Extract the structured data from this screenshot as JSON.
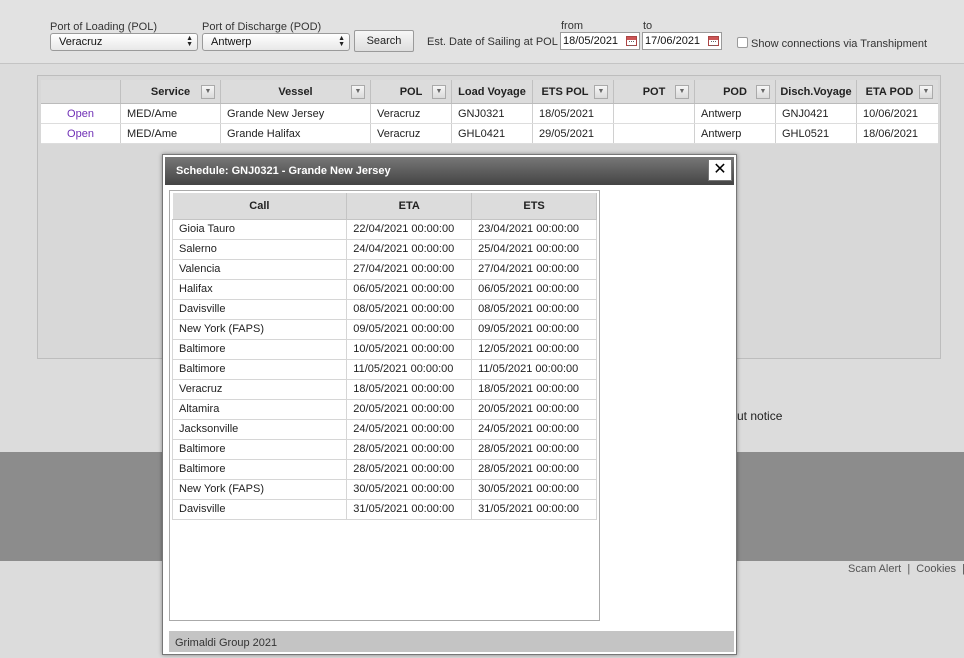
{
  "search": {
    "pol_label": "Port of Loading (POL)",
    "pol_value": "Veracruz",
    "pod_label": "Port of Discharge (POD)",
    "pod_value": "Antwerp",
    "search_button": "Search",
    "sailing_label": "Est. Date of Sailing at POL",
    "from_label": "from",
    "from_value": "18/05/2021",
    "to_label": "to",
    "to_value": "17/06/2021",
    "transhipment_label": "Show connections via Transhipment"
  },
  "results": {
    "columns": [
      "",
      "Service",
      "Vessel",
      "POL",
      "Load Voyage",
      "ETS POL",
      "POT",
      "POD",
      "Disch.Voyage",
      "ETA POD"
    ],
    "rows": [
      [
        "Open",
        "MED/Ame",
        "Grande New Jersey",
        "Veracruz",
        "GNJ0321",
        "18/05/2021",
        "",
        "Antwerp",
        "GNJ0421",
        "10/06/2021"
      ],
      [
        "Open",
        "MED/Ame",
        "Grande Halifax",
        "Veracruz",
        "GHL0421",
        "29/05/2021",
        "",
        "Antwerp",
        "GHL0521",
        "18/06/2021"
      ]
    ]
  },
  "notice_text": "ut notice",
  "footer_links": {
    "scam": "Scam Alert",
    "sep": "|",
    "cookies": "Cookies",
    "sep2": "|"
  },
  "modal": {
    "title": "Schedule: GNJ0321 - Grande New Jersey",
    "close": "✕",
    "columns": [
      "Call",
      "ETA",
      "ETS"
    ],
    "rows": [
      [
        "Gioia Tauro",
        "22/04/2021 00:00:00",
        "23/04/2021 00:00:00"
      ],
      [
        "Salerno",
        "24/04/2021 00:00:00",
        "25/04/2021 00:00:00"
      ],
      [
        "Valencia",
        "27/04/2021 00:00:00",
        "27/04/2021 00:00:00"
      ],
      [
        "Halifax",
        "06/05/2021 00:00:00",
        "06/05/2021 00:00:00"
      ],
      [
        "Davisville",
        "08/05/2021 00:00:00",
        "08/05/2021 00:00:00"
      ],
      [
        "New York (FAPS)",
        "09/05/2021 00:00:00",
        "09/05/2021 00:00:00"
      ],
      [
        "Baltimore",
        "10/05/2021 00:00:00",
        "12/05/2021 00:00:00"
      ],
      [
        "Baltimore",
        "11/05/2021 00:00:00",
        "11/05/2021 00:00:00"
      ],
      [
        "Veracruz",
        "18/05/2021 00:00:00",
        "18/05/2021 00:00:00"
      ],
      [
        "Altamira",
        "20/05/2021 00:00:00",
        "20/05/2021 00:00:00"
      ],
      [
        "Jacksonville",
        "24/05/2021 00:00:00",
        "24/05/2021 00:00:00"
      ],
      [
        "Baltimore",
        "28/05/2021 00:00:00",
        "28/05/2021 00:00:00"
      ],
      [
        "Baltimore",
        "28/05/2021 00:00:00",
        "28/05/2021 00:00:00"
      ],
      [
        "New York (FAPS)",
        "30/05/2021 00:00:00",
        "30/05/2021 00:00:00"
      ],
      [
        "Davisville",
        "31/05/2021 00:00:00",
        "31/05/2021 00:00:00"
      ]
    ],
    "footer": "Grimaldi Group 2021"
  }
}
